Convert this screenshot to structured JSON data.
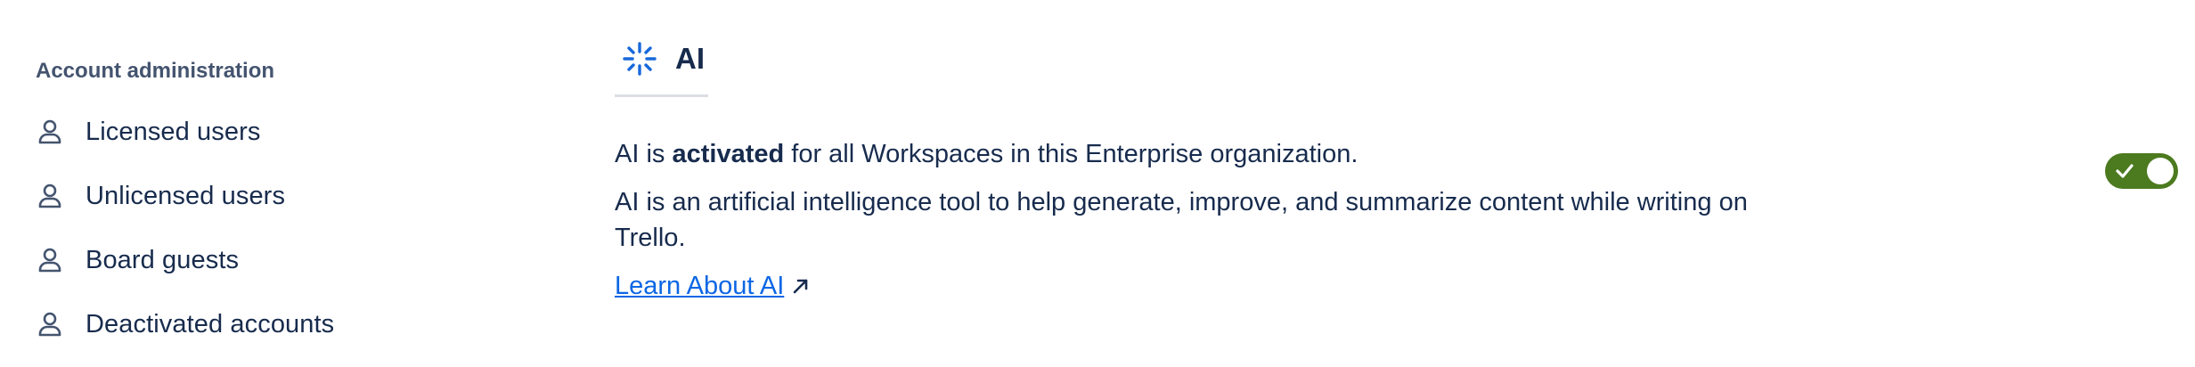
{
  "sidebar": {
    "heading": "Account administration",
    "items": [
      {
        "label": "Licensed users",
        "icon": "person-icon"
      },
      {
        "label": "Unlicensed users",
        "icon": "person-icon"
      },
      {
        "label": "Board guests",
        "icon": "person-icon"
      },
      {
        "label": "Deactivated accounts",
        "icon": "person-icon"
      }
    ]
  },
  "main": {
    "title": "AI",
    "title_icon": "ai-sparkle-icon",
    "status": {
      "prefix": "AI is ",
      "emphasis": "activated",
      "suffix": " for all Workspaces in this Enterprise organization."
    },
    "description": "AI is an artificial intelligence tool to help generate, improve, and summarize content while writing on Trello.",
    "link": {
      "label": "Learn About AI",
      "icon": "external-link-icon"
    },
    "toggle": {
      "state": "on",
      "color": "#4c7a1f"
    }
  },
  "colors": {
    "text": "#172b4d",
    "muted": "#44546f",
    "link": "#0c66e4",
    "accent": "#1868db"
  }
}
